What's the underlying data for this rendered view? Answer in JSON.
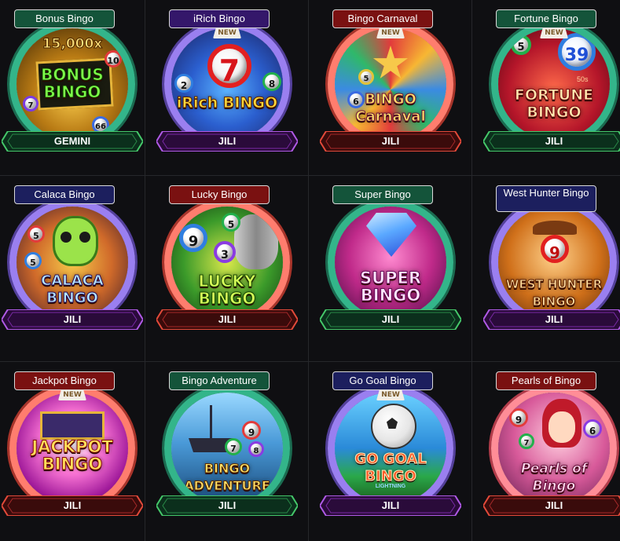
{
  "games": [
    {
      "title": "Bonus Bingo",
      "provider": "GEMINI",
      "is_new": false,
      "tag_color": "green",
      "ring": "green",
      "plate": "green",
      "logo_text": "BONUS BINGO",
      "multiplier": "15,000x",
      "balls": [
        "10",
        "7",
        "66"
      ]
    },
    {
      "title": "iRich Bingo",
      "provider": "JILI",
      "is_new": true,
      "tag_color": "purple",
      "ring": "purple",
      "plate": "purple",
      "logo_text": "iRich BINGO",
      "balls": [
        "7",
        "2",
        "8"
      ]
    },
    {
      "title": "Bingo Carnaval",
      "provider": "JILI",
      "is_new": true,
      "tag_color": "red",
      "ring": "red",
      "plate": "red",
      "logo_text": "BINGO Carnaval",
      "balls": [
        "5",
        "6",
        "2"
      ]
    },
    {
      "title": "Fortune Bingo",
      "provider": "JILI",
      "is_new": true,
      "tag_color": "green",
      "ring": "green",
      "plate": "green",
      "logo_text": "FORTUNE BINGO",
      "balls": [
        "5",
        "39",
        "50s"
      ]
    },
    {
      "title": "Calaca Bingo",
      "provider": "JILI",
      "is_new": false,
      "tag_color": "navy",
      "ring": "purple",
      "plate": "purple",
      "logo_text": "CALACA BINGO",
      "balls": [
        "5",
        "5"
      ]
    },
    {
      "title": "Lucky Bingo",
      "provider": "JILI",
      "is_new": false,
      "tag_color": "red",
      "ring": "red",
      "plate": "red",
      "logo_text": "LUCKY BINGO",
      "balls": [
        "9",
        "5",
        "3"
      ]
    },
    {
      "title": "Super Bingo",
      "provider": "JILI",
      "is_new": false,
      "tag_color": "green",
      "ring": "green",
      "plate": "green",
      "logo_text": "SUPER BINGO",
      "balls": []
    },
    {
      "title": "West Hunter Bingo",
      "provider": "JILI",
      "is_new": false,
      "tag_color": "navy",
      "ring": "purple",
      "plate": "purple",
      "logo_text": "WEST HUNTER BINGO",
      "balls": [
        "9"
      ]
    },
    {
      "title": "Jackpot Bingo",
      "provider": "JILI",
      "is_new": true,
      "tag_color": "red",
      "ring": "red",
      "plate": "red",
      "logo_text": "JACKPOT BINGO",
      "balls": []
    },
    {
      "title": "Bingo Adventure",
      "provider": "JILI",
      "is_new": false,
      "tag_color": "green",
      "ring": "green",
      "plate": "green",
      "logo_text": "BINGO ADVENTURE",
      "balls": [
        "9",
        "7",
        "8"
      ]
    },
    {
      "title": "Go Goal Bingo",
      "provider": "JILI",
      "is_new": true,
      "tag_color": "navy",
      "ring": "purple",
      "plate": "purple",
      "logo_text": "GO GOAL BINGO",
      "subtitle": "LIGHTNING",
      "balls": []
    },
    {
      "title": "Pearls of Bingo",
      "provider": "JILI",
      "is_new": false,
      "tag_color": "red",
      "ring": "pink",
      "plate": "red",
      "logo_text": "Pearls of Bingo",
      "balls": [
        "9",
        "6",
        "7"
      ]
    }
  ],
  "new_label": "NEW",
  "colors": {
    "green": "#2e9f6a",
    "purple": "#8a49d8",
    "red": "#d94131",
    "background": "#0d0d0f"
  }
}
